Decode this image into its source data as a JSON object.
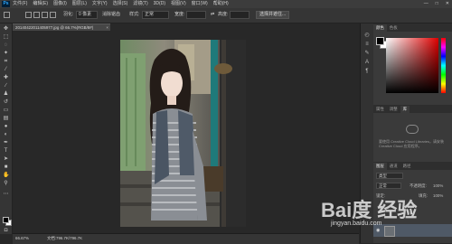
{
  "app": {
    "logo": "Ps"
  },
  "menu": {
    "items": [
      "文件(F)",
      "编辑(E)",
      "图像(I)",
      "图层(L)",
      "文字(Y)",
      "选择(S)",
      "滤镜(T)",
      "3D(D)",
      "视图(V)",
      "窗口(W)",
      "帮助(H)"
    ]
  },
  "window": {
    "minimize": "—",
    "maximize": "□",
    "close": "✕"
  },
  "options": {
    "feather_label": "羽化:",
    "feather_value": "0 像素",
    "antialias_label": "消除锯齿",
    "style_label": "样式:",
    "style_value": "正常",
    "width_label": "宽度:",
    "height_label": "高度:",
    "select_mask_button": "选择并遮住..."
  },
  "document": {
    "tab_title": "20140422011405977.jpg @ 66.7%(RGB/8#)",
    "tab_close": "×"
  },
  "status": {
    "zoom": "66.67%",
    "doc": "文档:796.7K/796.7K"
  },
  "panels": {
    "color_tabs": [
      "颜色",
      "色板"
    ],
    "properties_tabs": [
      "属性",
      "调整",
      "库"
    ],
    "library_message": "要使用 Creative Cloud Libraries，请安装 Creative Cloud 应用程序。",
    "layers_tabs": [
      "图层",
      "通道",
      "路径"
    ],
    "layers_kind": "类型",
    "blend_mode": "正常",
    "opacity_label": "不透明度:",
    "opacity_value": "100%",
    "lock_label": "锁定:",
    "fill_label": "填充:",
    "fill_value": "100%"
  },
  "watermark": {
    "text": "Bai度 经验",
    "sub": "jingyan.baidu.com"
  },
  "colors": {
    "accent": "#31a8ff",
    "fg": "#000000",
    "bg": "#ffffff"
  }
}
